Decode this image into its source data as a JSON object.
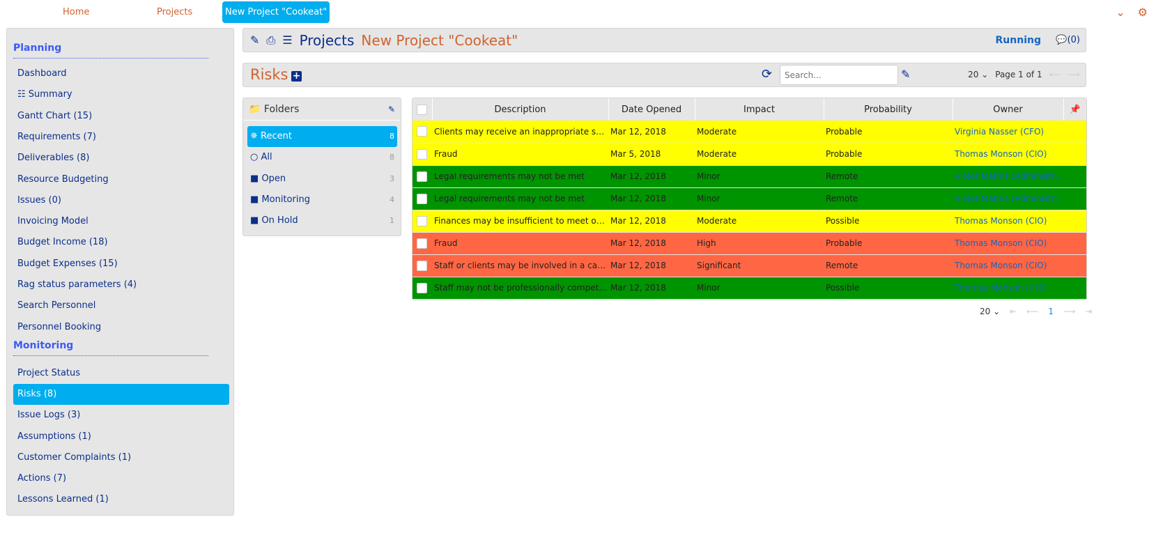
{
  "topnav": {
    "home": "Home",
    "projects": "Projects",
    "current": "New Project \"Cookeat\""
  },
  "header": {
    "section": "Projects",
    "project": "New Project \"Cookeat\"",
    "status": "Running",
    "comments": "(0)"
  },
  "sidebar": {
    "planning_title": "Planning",
    "planning": [
      "Dashboard",
      "Summary",
      "Gantt Chart (15)",
      "Requirements (7)",
      "Deliverables (8)",
      "Resource Budgeting",
      "Issues (0)",
      "Invoicing Model",
      "Budget Income (18)",
      "Budget Expenses (15)",
      "Rag status parameters (4)",
      "Search Personnel",
      "Personnel Booking"
    ],
    "monitoring_title": "Monitoring",
    "monitoring": [
      "Project Status",
      "Risks (8)",
      "Issue Logs (3)",
      "Assumptions (1)",
      "Customer Complaints (1)",
      "Actions (7)",
      "Lessons Learned (1)"
    ],
    "active": "Risks (8)"
  },
  "risks": {
    "title": "Risks",
    "search_placeholder": "Search...",
    "page_size": "20",
    "page_info": "Page 1 of 1"
  },
  "folders": {
    "title": "Folders",
    "items": [
      {
        "label": "Recent",
        "count": "8",
        "icon": "recent-icon"
      },
      {
        "label": "All",
        "count": "8",
        "icon": "circle-icon"
      },
      {
        "label": "Open",
        "count": "3",
        "icon": "folder-icon"
      },
      {
        "label": "Monitoring",
        "count": "4",
        "icon": "folder-icon"
      },
      {
        "label": "On Hold",
        "count": "1",
        "icon": "folder-icon"
      }
    ]
  },
  "table": {
    "columns": [
      "Description",
      "Date Opened",
      "Impact",
      "Probability",
      "Owner"
    ],
    "colors": {
      "yellow": "#ffff00",
      "green": "#009400",
      "red": "#ff6644"
    },
    "rows": [
      {
        "description": "Clients may receive an inappropriate service",
        "date": "Mar 12, 2018",
        "impact": "Moderate",
        "probability": "Probable",
        "owner": "Virginia Nasser (CFO)",
        "color": "yellow"
      },
      {
        "description": "Fraud",
        "date": "Mar 5, 2018",
        "impact": "Moderate",
        "probability": "Probable",
        "owner": "Thomas Monson (CIO)",
        "color": "yellow"
      },
      {
        "description": "Legal requirements may not be met",
        "date": "Mar 12, 2018",
        "impact": "Minor",
        "probability": "Remote",
        "owner": "Violet Mathis (Administrator)",
        "color": "green"
      },
      {
        "description": "Legal requirements may not be met",
        "date": "Mar 12, 2018",
        "impact": "Minor",
        "probability": "Remote",
        "owner": "Violet Mathis (Administrator)",
        "color": "green"
      },
      {
        "description": "Finances may be insufficient to meet operations",
        "date": "Mar 12, 2018",
        "impact": "Moderate",
        "probability": "Possible",
        "owner": "Thomas Monson (CIO)",
        "color": "yellow"
      },
      {
        "description": "Fraud",
        "date": "Mar 12, 2018",
        "impact": "High",
        "probability": "Probable",
        "owner": "Thomas Monson (CIO)",
        "color": "red"
      },
      {
        "description": "Staff or clients may be involved in a car accident",
        "date": "Mar 12, 2018",
        "impact": "Significant",
        "probability": "Remote",
        "owner": "Thomas Monson (CIO)",
        "color": "red"
      },
      {
        "description": "Staff may not be professionally competent",
        "date": "Mar 12, 2018",
        "impact": "Minor",
        "probability": "Possible",
        "owner": "Thomas Monson (CIO)",
        "color": "green"
      }
    ]
  },
  "bottom_pager": {
    "page_size": "20",
    "current_page": "1"
  }
}
